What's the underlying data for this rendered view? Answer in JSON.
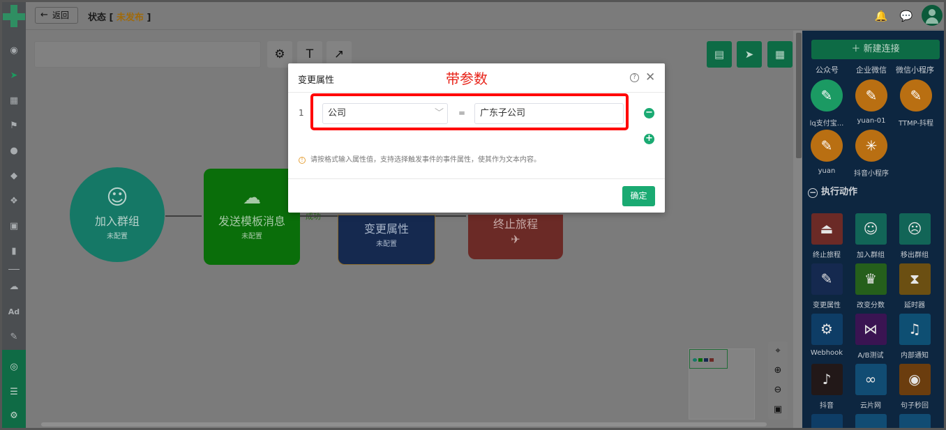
{
  "topbar": {
    "back_label": "返回",
    "status_label": "状态",
    "status_value": "未发布",
    "icons": [
      "bell-icon",
      "chat-icon",
      "avatar"
    ]
  },
  "leftnav": {
    "icons": [
      "dashboard-icon",
      "send-icon",
      "layout-icon",
      "flag-icon",
      "user-icon",
      "users-icon",
      "cluster-icon",
      "bookmark-icon",
      "bar-chart-icon",
      "wechat-icon",
      "ad-icon",
      "wrench-icon",
      "broadcast-icon",
      "server-icon",
      "settings-icon"
    ],
    "ad_text": "Ad"
  },
  "canvas": {
    "nodes": [
      {
        "title": "加入群组",
        "sub": "未配置"
      },
      {
        "title": "发送模板消息",
        "sub": "未配置"
      },
      {
        "title": "变更属性",
        "sub": "未配置"
      },
      {
        "title": "终止旅程",
        "sub": ""
      }
    ],
    "edge_label": "成功",
    "colors": {
      "circle": "#157866",
      "wechat": "#0a6e0a",
      "change": "#15294f",
      "terminate": "#6b2a26"
    }
  },
  "modal": {
    "title": "变更属性",
    "annotation": "带参数",
    "row_number": "1",
    "attribute_value": "公司",
    "equals": "=",
    "value": "广东子公司",
    "tip": "请按格式输入属性值，支持选择触发事件的事件属性，使其作为文本内容。",
    "confirm_label": "确定"
  },
  "rpanel": {
    "new_connection": "新建连接",
    "tabs": [
      "公众号",
      "企业微信",
      "微信小程序"
    ],
    "apps": [
      {
        "label": "lq支付宝...",
        "icon": "wrench-icon",
        "color": "#1b9a63"
      },
      {
        "label": "yuan-01",
        "icon": "wrench-icon",
        "color": "#b96f12"
      },
      {
        "label": "TTMP-抖程",
        "icon": "wrench-icon",
        "color": "#b96f12"
      },
      {
        "label": "yuan",
        "icon": "wrench-icon",
        "color": "#b96f12"
      },
      {
        "label": "抖音小程序",
        "icon": "star-icon",
        "color": "#b96f12"
      }
    ],
    "section_title": "执行动作",
    "actions": [
      {
        "label": "终止旅程",
        "icon": "eject-icon",
        "color": "#6b2a26"
      },
      {
        "label": "加入群组",
        "icon": "user-add-icon",
        "color": "#126557"
      },
      {
        "label": "移出群组",
        "icon": "user-remove-icon",
        "color": "#126557"
      },
      {
        "label": "变更属性",
        "icon": "edit-icon",
        "color": "#15294f"
      },
      {
        "label": "改变分数",
        "icon": "trophy-icon",
        "color": "#255f1b"
      },
      {
        "label": "延时器",
        "icon": "hourglass-icon",
        "color": "#6b4f12"
      },
      {
        "label": "Webhook",
        "icon": "webhook-icon",
        "color": "#0e3d66"
      },
      {
        "label": "A/B测试",
        "icon": "ab-icon",
        "color": "#3a1452"
      },
      {
        "label": "内部通知",
        "icon": "bell-icon",
        "color": "#0e4f73"
      },
      {
        "label": "抖音",
        "icon": "tiktok-icon",
        "color": "#221818"
      },
      {
        "label": "云片网",
        "icon": "cloud-icon",
        "color": "#114c73"
      },
      {
        "label": "句子秒回",
        "icon": "location-icon",
        "color": "#6b3d0e"
      }
    ]
  }
}
